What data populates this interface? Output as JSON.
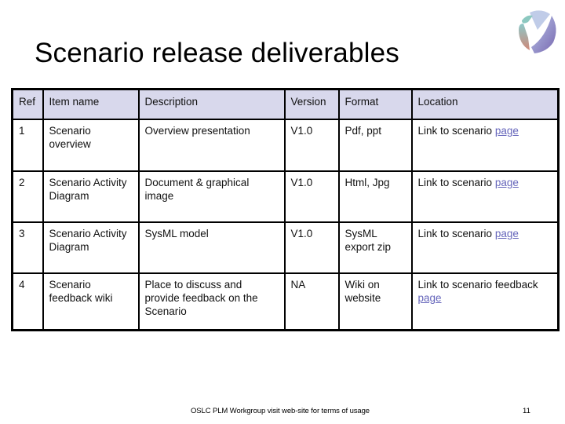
{
  "slide": {
    "title": "Scenario release deliverables",
    "logo_icon": "oslc-logo-icon",
    "footer_text": "OSLC PLM Workgroup visit web-site for terms of usage",
    "page_number": "11"
  },
  "colors": {
    "header_bg": "#d8d8ec",
    "link": "#6666bb",
    "border": "#000000"
  },
  "table": {
    "headers": [
      "Ref",
      "Item name",
      "Description",
      "Version",
      "Format",
      "Location"
    ],
    "rows": [
      {
        "ref": "1",
        "item_name": "Scenario overview",
        "description": "Overview presentation",
        "version": "V1.0",
        "format": "Pdf, ppt",
        "location_text": "Link to scenario",
        "location_link": "page"
      },
      {
        "ref": "2",
        "item_name": "Scenario Activity Diagram",
        "description": "Document & graphical image",
        "version": "V1.0",
        "format": "Html, Jpg",
        "location_text": "Link to scenario",
        "location_link": "page"
      },
      {
        "ref": "3",
        "item_name": "Scenario Activity Diagram",
        "description": "SysML model",
        "version": "V1.0",
        "format": "SysML export zip",
        "location_text": "Link to scenario",
        "location_link": "page"
      },
      {
        "ref": "4",
        "item_name": "Scenario feedback wiki",
        "description": "Place to discuss and provide feedback on the Scenario",
        "version": "NA",
        "format": "Wiki on website",
        "location_text": "Link to scenario feedback",
        "location_link": "page"
      }
    ]
  }
}
